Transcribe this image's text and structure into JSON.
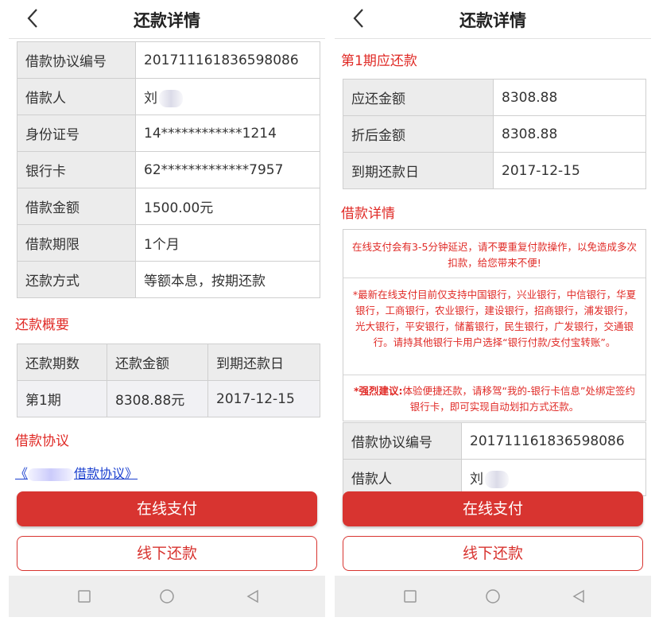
{
  "header": {
    "title": "还款详情"
  },
  "loan_details": [
    {
      "label": "借款协议编号",
      "value": "20171116183659808​6"
    },
    {
      "label": "借款人",
      "value": "刘"
    },
    {
      "label": "身份证号",
      "value": "14************1214"
    },
    {
      "label": "银行卡",
      "value": "62*************7957"
    },
    {
      "label": "借款金额",
      "value": "1500.00元"
    },
    {
      "label": "借款期限",
      "value": "1个月"
    },
    {
      "label": "还款方式",
      "value": "等额本息，按期还款"
    }
  ],
  "summary": {
    "title": "还款概要",
    "headers": [
      "还款期数",
      "还款金额",
      "到期还款日"
    ],
    "rows": [
      [
        "第1期",
        "8308.88元",
        "2017-12-15"
      ]
    ]
  },
  "agreement": {
    "title": "借款协议",
    "link_prefix": "《",
    "link_suffix": "借款协议》"
  },
  "buttons": {
    "online_pay": "在线支付",
    "offline_repay": "线下还款"
  },
  "period_due": {
    "title": "第1期应还款",
    "rows": [
      {
        "label": "应还金额",
        "value": "8308.88"
      },
      {
        "label": "折后金额",
        "value": "8308.88"
      },
      {
        "label": "到期还款日",
        "value": "2017-12-15"
      }
    ]
  },
  "loan_detail_section": {
    "title": "借款详情",
    "notice1": "在线支付会有3-5分钟延迟，请不要重复付款操作，以免造成多次扣款，给您带来不便!",
    "notice2": "*最新在线支付目前仅支持中国银行，兴业银行，中信银行，华夏银行，工商银行，农业银行，建设银行，招商银行，浦发银行，光大银行，平安银行，储蓄银行，民生银行，广发银行，交通银行。请持其他银行卡用户选择“银行付款/支付宝转账”。",
    "notice3_bold": "*强烈建议:",
    "notice3": "体验便捷还款，请移驾“我的-银行卡信息”处绑定签约银行卡，即可实现自动划扣方式还款。",
    "rows": [
      {
        "label": "借款协议编号",
        "value": "201711161836598086"
      },
      {
        "label": "借款人",
        "value": "刘"
      }
    ]
  },
  "colors": {
    "accent": "#d83430",
    "section_title": "#e02a26",
    "link": "#1a3fcf"
  },
  "icons": {
    "back": "chevron-left-icon",
    "nav_recent": "square-icon",
    "nav_home": "circle-icon",
    "nav_back": "triangle-back-icon"
  }
}
